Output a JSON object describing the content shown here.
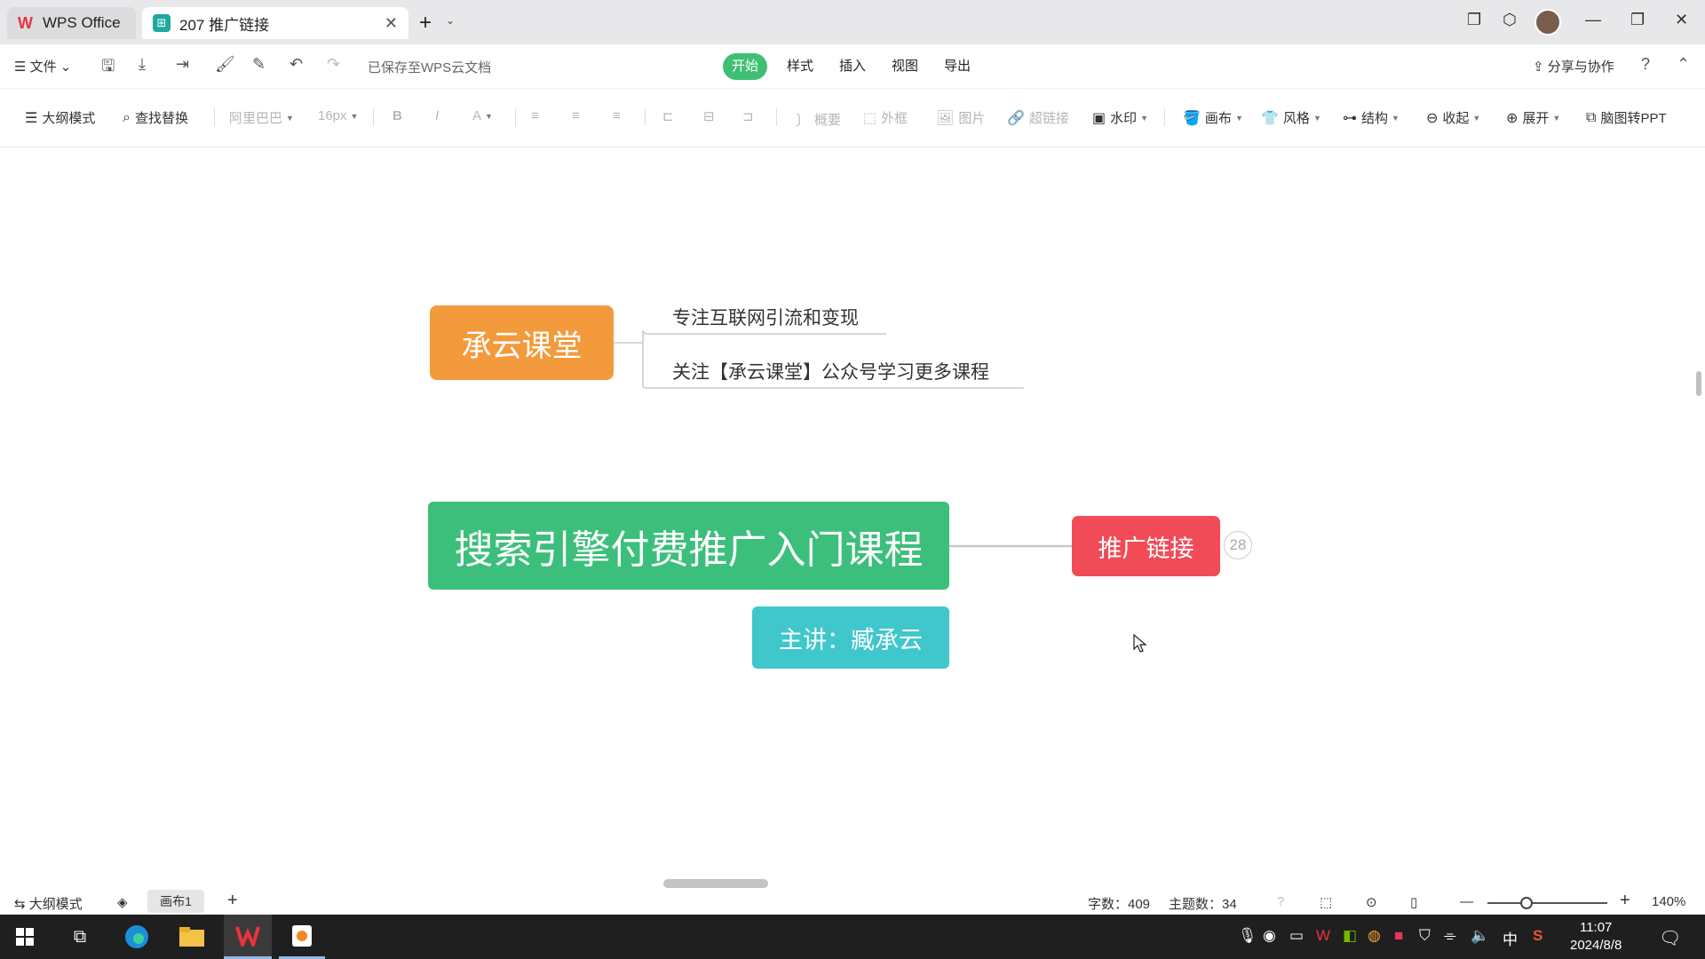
{
  "titlebar": {
    "tabs": [
      {
        "label": "WPS Office"
      },
      {
        "label": "207 推广链接"
      }
    ]
  },
  "menubar": {
    "file": "文件",
    "saved_status": "已保存至WPS云文档",
    "main_tabs": [
      "开始",
      "样式",
      "插入",
      "视图",
      "导出"
    ],
    "active_tab": "开始",
    "share": "分享与协作"
  },
  "toolbar": {
    "outline": "大纲模式",
    "find_replace": "查找替换",
    "font": "阿里巴巴",
    "font_size": "16px",
    "bold": "B",
    "italic": "I",
    "font_color": "A",
    "summary": "概要",
    "frame": "外框",
    "image": "图片",
    "hyperlink": "超链接",
    "watermark": "水印",
    "canvas": "画布",
    "style": "风格",
    "structure": "结构",
    "collapse": "收起",
    "expand": "展开",
    "to_ppt": "脑图转PPT"
  },
  "mindmap": {
    "topic_chengyun": "承云课堂",
    "leaf_1": "专注互联网引流和变现",
    "leaf_2": "关注【承云课堂】公众号学习更多课程",
    "main_topic": "搜索引擎付费推广入门课程",
    "topic_link": "推广链接",
    "link_count": "28",
    "speaker": "主讲：臧承云",
    "colors": {
      "orange": "#f39a3c",
      "green": "#3cbf7b",
      "red": "#f24b58",
      "teal": "#3fc7cc"
    }
  },
  "statusbar": {
    "outline": "大纲模式",
    "canvas_tab": "画布1",
    "word_count": "字数：409",
    "topic_count": "主题数：34",
    "zoom": "140%"
  },
  "taskbar": {
    "ime": "中",
    "time": "11:07",
    "date": "2024/8/8"
  }
}
